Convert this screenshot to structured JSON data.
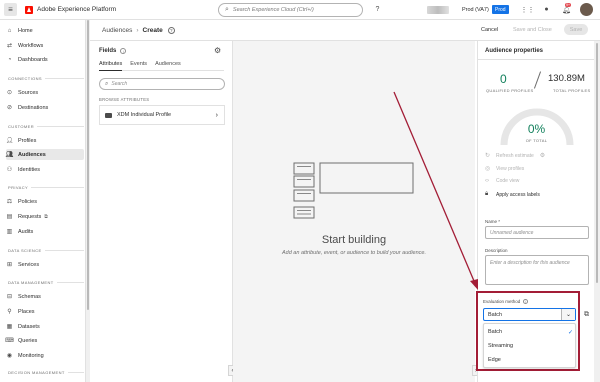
{
  "topbar": {
    "app_title": "Adobe Experience Platform",
    "search_placeholder": "Search Experience Cloud (Ctrl+/)",
    "sandbox_label": "Prod (VA7)",
    "sandbox_badge": "Prod",
    "notification_count": "9+"
  },
  "sidebar": {
    "items_top": [
      {
        "label": "Home",
        "icon": "home-icon"
      },
      {
        "label": "Workflows",
        "icon": "workflows-icon"
      },
      {
        "label": "Dashboards",
        "icon": "dashboards-icon"
      }
    ],
    "sections": [
      {
        "title": "CONNECTIONS"
      },
      {
        "title": "CUSTOMER"
      },
      {
        "title": "PRIVACY"
      },
      {
        "title": "DATA SCIENCE"
      },
      {
        "title": "DATA MANAGEMENT"
      },
      {
        "title": "DECISION MANAGEMENT"
      }
    ],
    "connections": [
      "Sources",
      "Destinations"
    ],
    "customer": [
      "Profiles",
      "Audiences",
      "Identities"
    ],
    "privacy": [
      "Policies",
      "Requests",
      "Audits"
    ],
    "data_science": [
      "Services"
    ],
    "data_management": [
      "Schemas",
      "Places",
      "Datasets",
      "Queries",
      "Monitoring"
    ],
    "active": "Audiences"
  },
  "header": {
    "breadcrumb_parent": "Audiences",
    "breadcrumb_current": "Create",
    "cancel": "Cancel",
    "save_and_close": "Save and Close",
    "save": "Save"
  },
  "fields": {
    "title": "Fields",
    "tabs": [
      "Attributes",
      "Events",
      "Audiences"
    ],
    "active_tab": "Attributes",
    "search_placeholder": "Search",
    "browse_label": "BROWSE ATTRIBUTES",
    "browse_item": "XDM Individual Profile"
  },
  "canvas": {
    "title": "Start building",
    "subtitle": "Add an attribute, event, or audience to build your audience."
  },
  "properties": {
    "title": "Audience properties",
    "qualified_value": "0",
    "qualified_label": "QUALIFIED PROFILES",
    "total_value": "130.89M",
    "total_label": "TOTAL PROFILES",
    "percent_value": "0%",
    "percent_fraction": 0,
    "percent_label": "OF TOTAL",
    "links": [
      "Refresh estimate",
      "View profiles",
      "Code view",
      "Apply access labels"
    ],
    "name_label": "Name *",
    "name_placeholder": "Unnamed audience",
    "description_label": "Description",
    "description_placeholder": "Enter a description for this audience",
    "evaluation_label": "Evaluation method",
    "evaluation_value": "Batch",
    "evaluation_options": [
      "Batch",
      "Streaming",
      "Edge"
    ],
    "selected_option": "Batch"
  },
  "colors": {
    "accent_blue": "#1473e6",
    "positive_green": "#12805c",
    "annotation_red": "#a31d36",
    "adobe_red": "#fa0f00"
  }
}
